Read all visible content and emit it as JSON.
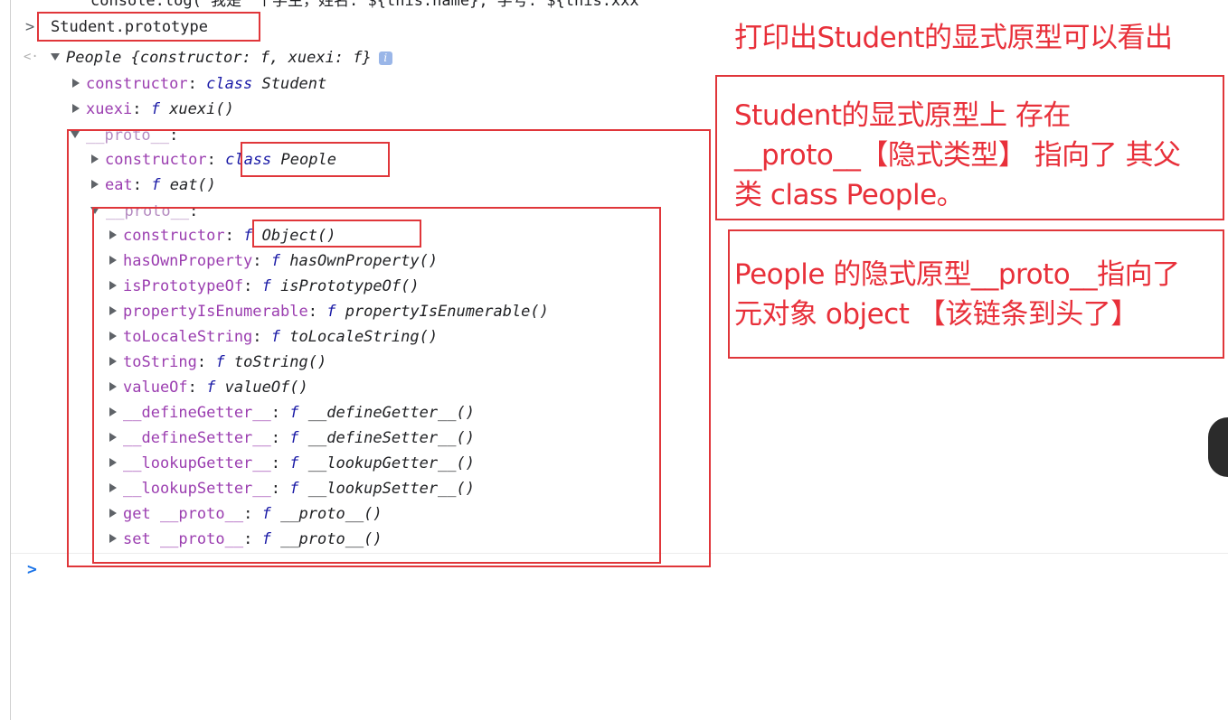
{
  "partial_top_line": "console.log(`我是一个学生，姓名: ${this.name}, 学号: ${this.xxx",
  "input": {
    "prompt_glyph": ">",
    "command": "Student.prototype"
  },
  "output": {
    "result_glyph": "<·",
    "summary": "People {constructor: f, xuexi: f}",
    "info_badge": "i",
    "level1": {
      "constructor_key": "constructor",
      "constructor_kw": "class",
      "constructor_val": "Student",
      "xuexi_key": "xuexi",
      "xuexi_f": "f",
      "xuexi_val": "xuexi()",
      "proto_key": "__proto__",
      "colon": ":"
    },
    "level2": {
      "constructor_key": "constructor",
      "constructor_kw": "class",
      "constructor_val": "People",
      "eat_key": "eat",
      "eat_f": "f",
      "eat_val": "eat()",
      "proto_key": "__proto__"
    },
    "level3": [
      {
        "key": "constructor",
        "f": "f",
        "val": "Object()"
      },
      {
        "key": "hasOwnProperty",
        "f": "f",
        "val": "hasOwnProperty()"
      },
      {
        "key": "isPrototypeOf",
        "f": "f",
        "val": "isPrototypeOf()"
      },
      {
        "key": "propertyIsEnumerable",
        "f": "f",
        "val": "propertyIsEnumerable()"
      },
      {
        "key": "toLocaleString",
        "f": "f",
        "val": "toLocaleString()"
      },
      {
        "key": "toString",
        "f": "f",
        "val": "toString()"
      },
      {
        "key": "valueOf",
        "f": "f",
        "val": "valueOf()"
      },
      {
        "key": "__defineGetter__",
        "f": "f",
        "val": "__defineGetter__()"
      },
      {
        "key": "__defineSetter__",
        "f": "f",
        "val": "__defineSetter__()"
      },
      {
        "key": "__lookupGetter__",
        "f": "f",
        "val": "__lookupGetter__()"
      },
      {
        "key": "__lookupSetter__",
        "f": "f",
        "val": "__lookupSetter__()"
      },
      {
        "key": "get __proto__",
        "f": "f",
        "val": "__proto__()"
      },
      {
        "key": "set __proto__",
        "f": "f",
        "val": "__proto__()"
      }
    ]
  },
  "bottom_prompt": ">",
  "annotations": {
    "note1": "打印出Student的显式原型可以看出",
    "note2_line1": "Student的显式原型上 存在",
    "note2_line2": "__proto__【隐式类型】 指向了 其父",
    "note2_line3": "类 class People。",
    "note3_line1": "People 的隐式原型__proto__指向了",
    "note3_line2": "元对象 object 【该链条到头了】"
  },
  "colors": {
    "annotation_red": "#e8303a",
    "key_purple": "#9b3eb0",
    "keyword_blue": "#1a1aa6"
  }
}
